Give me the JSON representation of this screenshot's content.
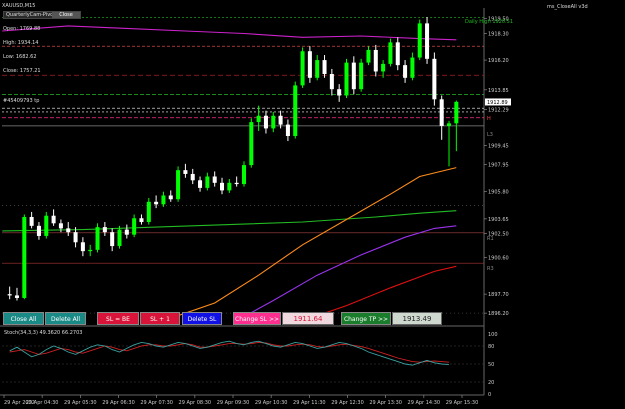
{
  "symbol": "XAUUSD,M15",
  "ea_name": "ms_CloseAll v3d",
  "panel": {
    "title": "QuarterlyCam-Pivots",
    "title_button": "Close",
    "open": "Open: 1769.88",
    "high": "High: 1934.14",
    "low": "Low: 1682.62",
    "close": "Close: 1757.21"
  },
  "order_label": "#45409793 tp",
  "daily_high_label": "Daily High 1920.51",
  "level_labels": {
    "h": "H",
    "l3": "L3",
    "r1": "R1",
    "r3": "R3"
  },
  "price_axis": {
    "ticks": [
      "1919.50",
      "1918.30",
      "1916.20",
      "1913.85",
      "1912.29",
      "1909.45",
      "1907.95",
      "1905.80",
      "1903.65",
      "1902.50",
      "1900.60",
      "1897.70",
      "1896.20"
    ],
    "current_price": "1912.89"
  },
  "time_axis": {
    "ticks": [
      "29 Apr 2022",
      "29 Apr 04:30",
      "29 Apr 05:30",
      "29 Apr 06:30",
      "29 Apr 07:30",
      "29 Apr 08:30",
      "29 Apr 09:30",
      "29 Apr 10:30",
      "29 Apr 11:30",
      "29 Apr 12:30",
      "29 Apr 13:30",
      "29 Apr 14:30",
      "29 Apr 15:30"
    ]
  },
  "buttons": {
    "close_all": "Close All",
    "delete_all": "Delete All",
    "sl_be": "SL = BE",
    "sl_plus1": "SL + 1",
    "delete_sl": "Delete SL",
    "change_sl": "Change SL >>",
    "sl_value": "1911.64",
    "change_tp": "Change TP >>",
    "tp_value": "1913.49"
  },
  "stoch": {
    "label": "Stoch(34,3,3) 49.3620 66.2703",
    "levels": [
      "100",
      "80",
      "50",
      "20",
      "0"
    ]
  },
  "colors": {
    "bull": "#00ff00",
    "bear": "#ffffff",
    "ma_magenta": "#cc22cc",
    "ma_orange": "#ff8c1a",
    "ma_green": "#22bb22",
    "ma_purple": "#9933ee",
    "ma_red": "#dd1111",
    "sl_button": "#d8143a",
    "tp_button": "#1a7d2c"
  },
  "chart_data": {
    "type": "candlestick",
    "ylim": [
      1895.5,
      1920.0
    ],
    "candles": [
      [
        1897.7,
        1898.3,
        1897.3,
        1897.6
      ],
      [
        1897.6,
        1898.2,
        1897.2,
        1897.4
      ],
      [
        1897.4,
        1904.0,
        1897.3,
        1903.8
      ],
      [
        1903.8,
        1904.2,
        1902.9,
        1903.1
      ],
      [
        1903.1,
        1903.4,
        1902.0,
        1902.3
      ],
      [
        1902.3,
        1904.2,
        1902.1,
        1903.9
      ],
      [
        1903.9,
        1904.4,
        1903.1,
        1903.3
      ],
      [
        1903.3,
        1903.6,
        1902.6,
        1902.9
      ],
      [
        1902.9,
        1903.4,
        1902.3,
        1902.6
      ],
      [
        1902.6,
        1903.0,
        1901.4,
        1901.8
      ],
      [
        1901.8,
        1902.2,
        1900.7,
        1901.1
      ],
      [
        1901.1,
        1901.6,
        1900.7,
        1901.2
      ],
      [
        1901.2,
        1903.3,
        1901.0,
        1903.0
      ],
      [
        1903.0,
        1903.4,
        1902.3,
        1902.6
      ],
      [
        1902.6,
        1902.9,
        1901.1,
        1901.5
      ],
      [
        1901.5,
        1903.1,
        1901.3,
        1902.8
      ],
      [
        1902.8,
        1903.2,
        1902.1,
        1902.4
      ],
      [
        1902.4,
        1904.0,
        1902.2,
        1903.7
      ],
      [
        1903.7,
        1904.0,
        1903.2,
        1903.4
      ],
      [
        1903.4,
        1905.3,
        1903.2,
        1905.0
      ],
      [
        1905.0,
        1905.5,
        1904.5,
        1904.8
      ],
      [
        1904.8,
        1905.8,
        1904.6,
        1905.5
      ],
      [
        1905.5,
        1905.9,
        1905.0,
        1905.2
      ],
      [
        1905.2,
        1907.8,
        1905.0,
        1907.5
      ],
      [
        1907.5,
        1908.0,
        1906.9,
        1907.2
      ],
      [
        1907.2,
        1907.6,
        1906.4,
        1906.7
      ],
      [
        1906.7,
        1907.0,
        1905.8,
        1906.1
      ],
      [
        1906.1,
        1907.3,
        1905.9,
        1907.0
      ],
      [
        1907.0,
        1907.4,
        1906.2,
        1906.5
      ],
      [
        1906.5,
        1906.9,
        1905.6,
        1905.9
      ],
      [
        1905.9,
        1906.8,
        1905.7,
        1906.5
      ],
      [
        1906.5,
        1907.0,
        1906.2,
        1906.4
      ],
      [
        1906.4,
        1908.2,
        1906.2,
        1907.9
      ],
      [
        1907.9,
        1911.6,
        1907.7,
        1911.3
      ],
      [
        1911.3,
        1912.6,
        1910.6,
        1911.8
      ],
      [
        1911.8,
        1912.2,
        1910.4,
        1910.8
      ],
      [
        1910.8,
        1912.1,
        1910.5,
        1911.8
      ],
      [
        1911.8,
        1912.2,
        1910.8,
        1911.1
      ],
      [
        1911.1,
        1911.5,
        1909.8,
        1910.2
      ],
      [
        1910.2,
        1914.5,
        1910.0,
        1914.2
      ],
      [
        1914.2,
        1917.2,
        1914.0,
        1916.9
      ],
      [
        1916.9,
        1917.3,
        1914.4,
        1914.8
      ],
      [
        1914.8,
        1916.6,
        1914.6,
        1916.2
      ],
      [
        1916.2,
        1916.6,
        1914.8,
        1915.1
      ],
      [
        1915.1,
        1915.5,
        1913.4,
        1913.9
      ],
      [
        1913.9,
        1914.3,
        1912.9,
        1913.4
      ],
      [
        1913.4,
        1916.3,
        1913.2,
        1916.0
      ],
      [
        1916.0,
        1916.5,
        1913.5,
        1913.9
      ],
      [
        1913.9,
        1916.3,
        1913.7,
        1916.0
      ],
      [
        1916.0,
        1917.3,
        1915.8,
        1917.0
      ],
      [
        1917.0,
        1917.4,
        1914.9,
        1915.3
      ],
      [
        1915.3,
        1916.2,
        1914.8,
        1915.9
      ],
      [
        1915.9,
        1917.9,
        1915.7,
        1917.6
      ],
      [
        1917.6,
        1918.0,
        1915.4,
        1915.8
      ],
      [
        1915.8,
        1916.2,
        1914.4,
        1914.8
      ],
      [
        1914.8,
        1916.8,
        1914.6,
        1916.4
      ],
      [
        1916.4,
        1919.4,
        1916.2,
        1919.1
      ],
      [
        1919.1,
        1919.6,
        1915.9,
        1916.3
      ],
      [
        1916.3,
        1916.8,
        1912.6,
        1913.1
      ],
      [
        1913.1,
        1913.4,
        1909.9,
        1911.0
      ],
      [
        1911.0,
        1911.4,
        1907.8,
        1911.2
      ],
      [
        1911.2,
        1913.0,
        1909.0,
        1912.9
      ]
    ]
  }
}
